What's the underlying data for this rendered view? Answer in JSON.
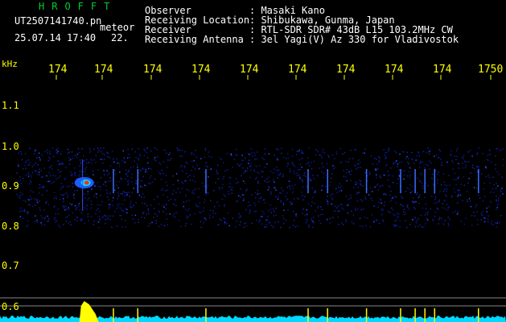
{
  "header": {
    "logo": "HROFFT",
    "filename": "UT2507141740.pn",
    "filetype": "meteor",
    "datetime": "25.07.14 17:40",
    "number": "22.",
    "info": [
      {
        "label": "Observer",
        "value": ": Masaki Kano"
      },
      {
        "label": "Receiving Location",
        "value": ": Shibukawa, Gunma, Japan"
      },
      {
        "label": "Receiver",
        "value": ": RTL-SDR SDR# 43dB L15 103.2MHz CW"
      },
      {
        "label": "Receiving Antenna",
        "value": ": 3el Yagi(V) Az 330 for Vladivostok"
      }
    ]
  },
  "axis": {
    "unit": "kHz",
    "time_ticks": [
      "174",
      "174",
      "174",
      "174",
      "174",
      "174",
      "174",
      "174",
      "174",
      "1750"
    ],
    "freq_ticks": [
      "1.1",
      "1.0",
      "0.9",
      "0.8",
      "0.7",
      "0.6"
    ]
  },
  "colors": {
    "axis_text": "#ffff00",
    "logo": "#00cc33",
    "noise": "#0a1a8c",
    "echo_core": "#ff3300",
    "bottom_trace": "#00d8ff",
    "bottom_peak": "#ffff00"
  },
  "meteor_echoes_minutes": [
    2.0,
    2.5,
    3.9,
    6.0,
    6.4,
    7.2,
    7.9,
    8.2,
    8.4,
    8.6,
    9.5
  ]
}
